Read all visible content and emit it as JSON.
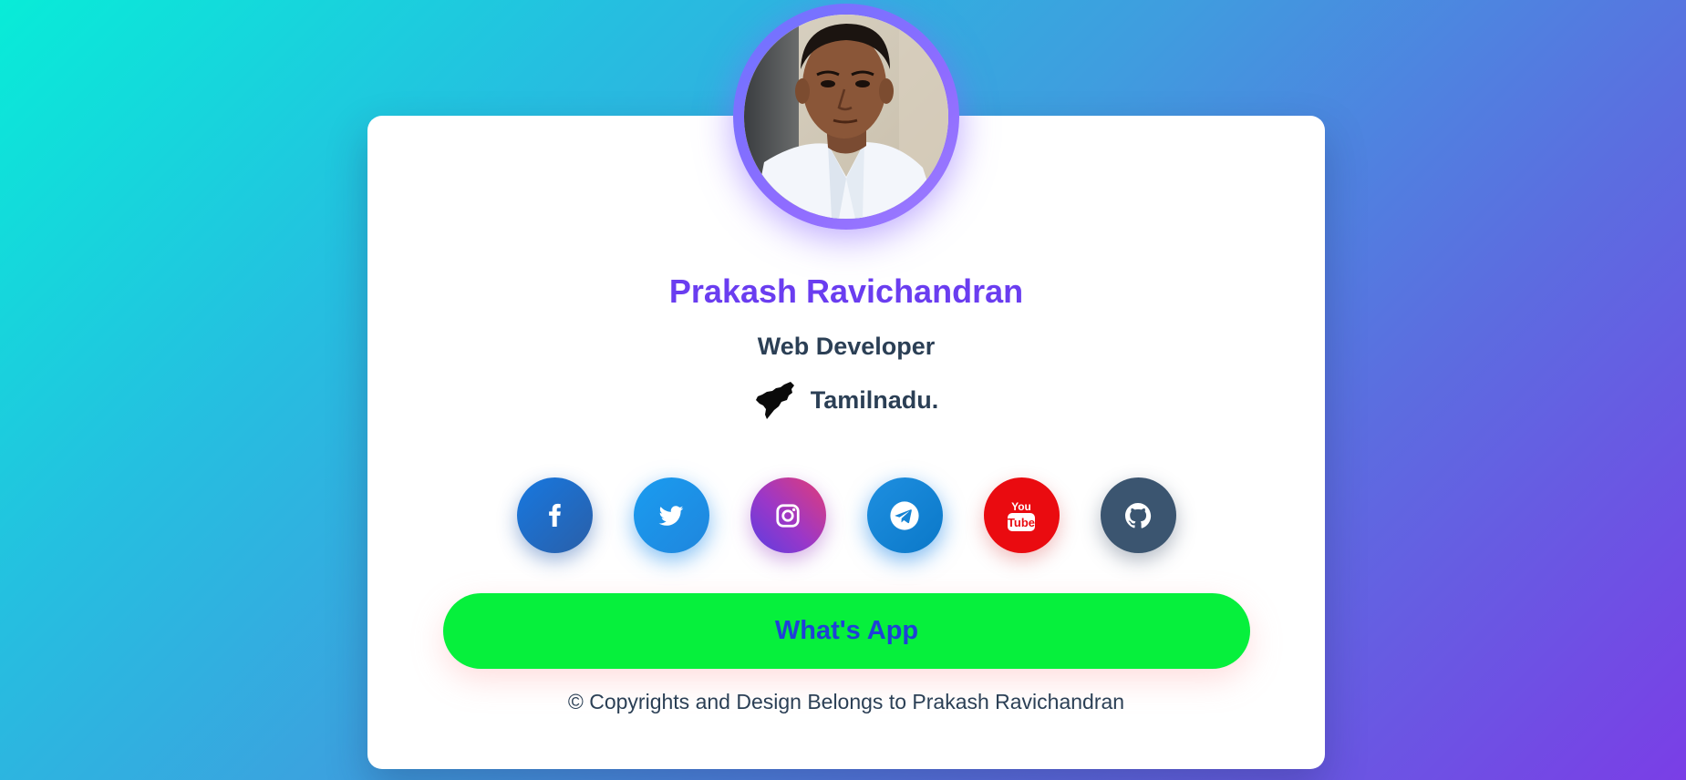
{
  "profile": {
    "name": "Prakash Ravichandran",
    "role": "Web Developer",
    "location": "Tamilnadu.",
    "avatar_icon": "profile-photo"
  },
  "socials": [
    {
      "name": "Facebook",
      "icon": "facebook-icon",
      "color": "#1f6cc7"
    },
    {
      "name": "Twitter",
      "icon": "twitter-icon",
      "color": "#1c96ea"
    },
    {
      "name": "Instagram",
      "icon": "instagram-icon",
      "color": "#b03aa8"
    },
    {
      "name": "Telegram",
      "icon": "telegram-icon",
      "color": "#1583d4"
    },
    {
      "name": "YouTube",
      "icon": "youtube-icon",
      "color": "#ea0b10"
    },
    {
      "name": "GitHub",
      "icon": "github-icon",
      "color": "#3b5570"
    }
  ],
  "whatsapp_label": "What's App",
  "footer": "© Copyrights and Design Belongs to Prakash Ravichandran",
  "colors": {
    "name": "#6a3df0",
    "text": "#2b3f55",
    "whatsapp_bg": "#06f03c",
    "whatsapp_text": "#1f40d8",
    "avatar_ring": "#7f6dff"
  }
}
